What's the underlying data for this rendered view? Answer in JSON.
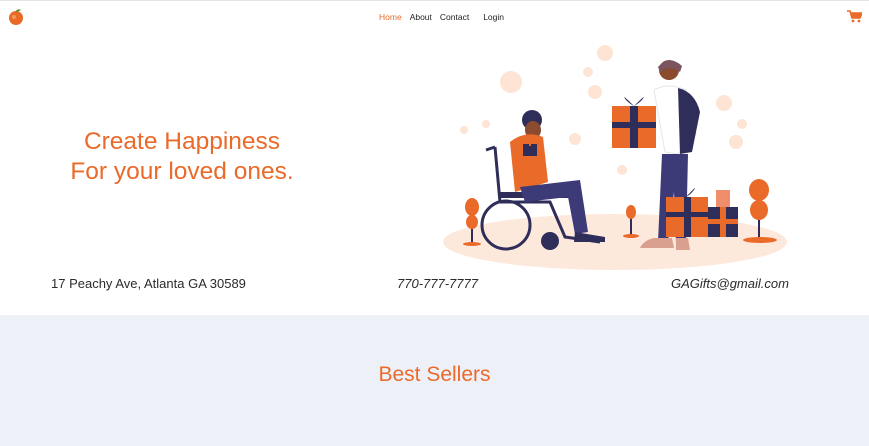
{
  "nav": {
    "links": [
      "Home",
      "About",
      "Contact",
      "Login"
    ],
    "active": "Home",
    "logo_icon": "peach-logo-icon",
    "cart_icon": "shopping-cart-icon"
  },
  "hero": {
    "title_line1": "Create Happiness",
    "title_line2": "For your loved ones.",
    "illustration": "gift-giving-illustration"
  },
  "contact": {
    "address": "17 Peachy Ave, Atlanta GA 30589",
    "phone": "770-777-7777",
    "email": "GAGifts@gmail.com"
  },
  "best_sellers": {
    "title": "Best Sellers"
  },
  "colors": {
    "accent": "#ea6a2a",
    "section_bg": "#eef0f7",
    "navy": "#2f2e5a"
  }
}
